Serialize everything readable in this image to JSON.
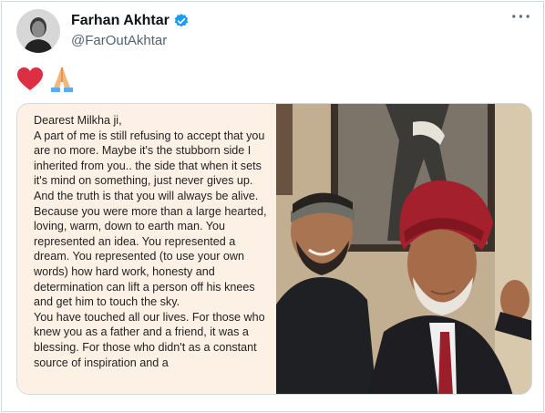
{
  "tweet": {
    "author_name": "Farhan Akhtar",
    "author_handle": "@FarOutAkhtar",
    "verified": true,
    "more_label": "···",
    "emojis": [
      "red-heart",
      "folded-hands"
    ]
  },
  "letter": {
    "paragraphs": [
      "Dearest Milkha ji,",
      "A part of me is still refusing to accept that you are no more. Maybe it's the stubborn side I inherited from you.. the side that when it sets it's mind on something, just never gives up.",
      "And the truth is that you will always be alive. Because you were more than a large hearted, loving, warm, down to earth man. You represented an idea. You represented a dream. You represented (to use your own words) how hard work, honesty and determination can lift a person off his knees and get him to touch the sky.",
      "You have touched all our lives. For those who knew you as a father and a friend, it was a blessing. For those who didn't as a constant source of inspiration and a"
    ]
  },
  "colors": {
    "verified_blue": "#1d9bf0",
    "handle_gray": "#536471",
    "letter_bg": "#fdf1e6",
    "turban_red": "#a3202c"
  }
}
